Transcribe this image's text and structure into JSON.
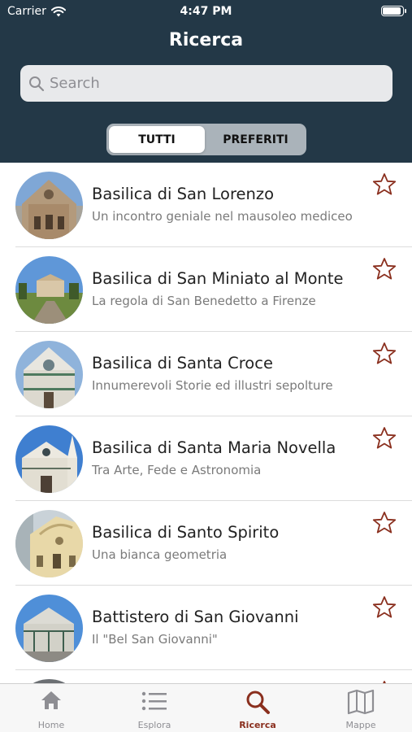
{
  "status_bar": {
    "carrier": "Carrier",
    "time": "4:47 PM"
  },
  "header": {
    "title": "Ricerca"
  },
  "search": {
    "placeholder": "Search"
  },
  "segments": {
    "all_label": "TUTTI",
    "favorites_label": "PREFERITI",
    "selected": "TUTTI"
  },
  "accent_color": "#8a2f1e",
  "header_color": "#233847",
  "list": [
    {
      "title": "Basilica di San Lorenzo",
      "subtitle": "Un incontro geniale nel mausoleo mediceo",
      "favorite": false
    },
    {
      "title": "Basilica di San Miniato al Monte",
      "subtitle": "La regola di San Benedetto a Firenze",
      "favorite": false
    },
    {
      "title": "Basilica di Santa Croce",
      "subtitle": "Innumerevoli Storie ed illustri sepolture",
      "favorite": false
    },
    {
      "title": "Basilica di Santa Maria Novella",
      "subtitle": "Tra Arte, Fede e Astronomia",
      "favorite": false
    },
    {
      "title": "Basilica di Santo Spirito",
      "subtitle": "Una bianca geometria",
      "favorite": false
    },
    {
      "title": "Battistero di San Giovanni",
      "subtitle": "Il \"Bel San Giovanni\"",
      "favorite": false
    }
  ],
  "tabbar": {
    "home": "Home",
    "explore": "Esplora",
    "search": "Ricerca",
    "maps": "Mappe",
    "active": "Ricerca"
  }
}
